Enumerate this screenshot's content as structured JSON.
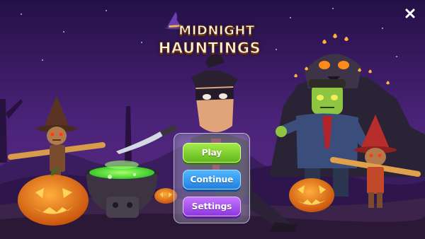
{
  "game": {
    "title_line1": "MIDNIGHT",
    "title_line2": "HAUNTINGS"
  },
  "menu": {
    "play_label": "Play",
    "continue_label": "Continue",
    "settings_label": "Settings"
  },
  "close_icon": "close-icon",
  "colors": {
    "sky": "#3a1c63",
    "play_button": "#6cc224",
    "continue_button": "#2a8ae8",
    "settings_button": "#9a42e8",
    "pumpkin": "#f07a18",
    "cauldron_glow": "#7dff5a"
  }
}
